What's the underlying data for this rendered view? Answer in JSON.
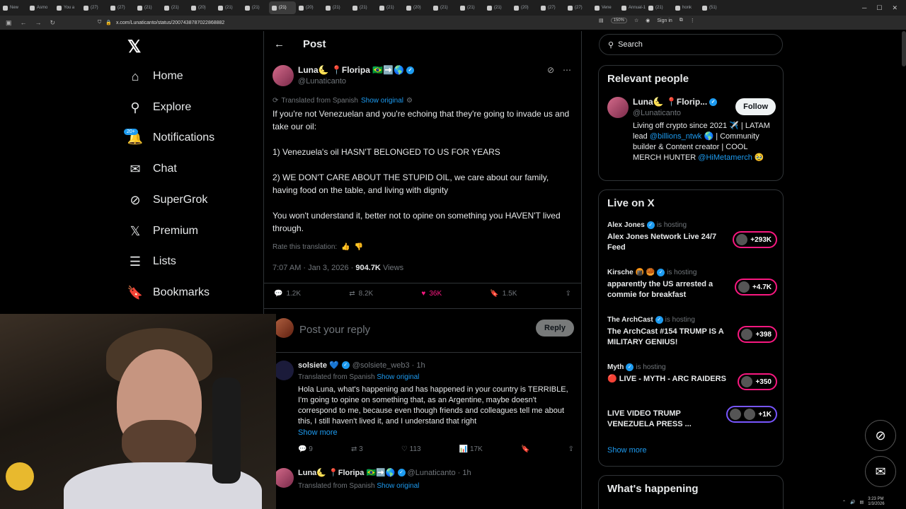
{
  "browser": {
    "tabs": [
      "New",
      "Asmo",
      "You a",
      "(27)",
      "(27)",
      "(21)",
      "(21)",
      "(20)",
      "(21)",
      "(21)",
      "(21)",
      "(20)",
      "(21)",
      "(21)",
      "(21)",
      "(20)",
      "(21)",
      "(21)",
      "(21)",
      "(20)",
      "(27)",
      "(27)",
      "Vene",
      "Annual-1",
      "(21)",
      "honk",
      "(51)"
    ],
    "active_tab_index": 10,
    "url": "x.com/Lunaticanto/status/2007438787022868882",
    "zoom": "150%",
    "sign_in": "Sign in"
  },
  "sidebar": {
    "items": [
      {
        "label": "Home",
        "icon": "home-icon"
      },
      {
        "label": "Explore",
        "icon": "search-icon"
      },
      {
        "label": "Notifications",
        "icon": "bell-icon",
        "badge": "20+"
      },
      {
        "label": "Chat",
        "icon": "mail-icon"
      },
      {
        "label": "SuperGrok",
        "icon": "grok-icon"
      },
      {
        "label": "Premium",
        "icon": "x-icon"
      },
      {
        "label": "Lists",
        "icon": "list-icon"
      },
      {
        "label": "Bookmarks",
        "icon": "bookmark-icon"
      }
    ]
  },
  "post": {
    "header": "Post",
    "author_name": "Luna🌜 📍Floripa 🇧🇷➡️🌎",
    "author_handle": "@Lunaticanto",
    "translated_label": "Translated from Spanish",
    "show_original": "Show original",
    "paragraphs": [
      "If you're not Venezuelan and you're echoing that they're going to invade us and take our oil:",
      "1) Venezuela's oil HASN'T BELONGED TO US FOR YEARS",
      "2) WE DON'T CARE ABOUT THE STUPID OIL, we care about our family, having food on the table, and living with dignity",
      "You won't understand it, better not to opine on something you HAVEN'T lived through."
    ],
    "rate_translation": "Rate this translation:",
    "time": "7:07 AM · Jan 3, 2026 · ",
    "views_count": "904.7K",
    "views_label": " Views",
    "actions": {
      "replies": "1.2K",
      "reposts": "8.2K",
      "likes": "36K",
      "bookmarks": "1.5K"
    },
    "reply_placeholder": "Post your reply",
    "reply_button": "Reply"
  },
  "comments": [
    {
      "name": "solsiete 💙",
      "handle": "@solsiete_web3 · 1h",
      "translated_label": "Translated from Spanish",
      "show_original": "Show original",
      "text": "Hola Luna, what's happening and has happened in your country is TERRIBLE, I'm going to opine on something that, as an Argentine, maybe doesn't correspond to me, because even though friends and colleagues tell me about this, I still haven't lived it, and I understand that right",
      "show_more": "Show more",
      "replies": "9",
      "reposts": "3",
      "likes": "113",
      "views": "17K"
    },
    {
      "name": "Luna🌜 📍Floripa 🇧🇷➡️🌎",
      "handle": "@Lunaticanto · 1h",
      "translated_label": "Translated from Spanish",
      "show_original": "Show original"
    }
  ],
  "right": {
    "search_placeholder": "Search",
    "relevant_title": "Relevant people",
    "relevant": {
      "name": "Luna🌜 📍Florip...",
      "handle": "@Lunaticanto",
      "follow": "Follow",
      "bio_1": "Living off crypto since 2021 ✈️ | LATAM lead ",
      "bio_link1": "@billions_ntwk",
      "bio_2": " 🌎 | Community builder & Content creator | COOL MERCH HUNTER ",
      "bio_link2": "@HiMetamerch",
      "bio_3": " 🥹"
    },
    "live_title": "Live on X",
    "live": [
      {
        "host": "Alex Jones",
        "hosting": "is hosting",
        "title": "Alex Jones Network Live 24/7 Feed",
        "count": "+293K"
      },
      {
        "host": "Kirsche 🍘 🥮",
        "hosting": "is hosting",
        "title": "apparently the US arrested a commie for breakfast",
        "count": "+4.7K"
      },
      {
        "host": "The ArchCast",
        "hosting": "is hosting",
        "title": "The ArchCast #154 TRUMP IS A MILITARY GENIUS!",
        "count": "+398"
      },
      {
        "host": "Myth",
        "hosting": "is hosting",
        "title": "🔴 LIVE - MYTH - ARC RAIDERS",
        "count": "+350"
      },
      {
        "host": "",
        "hosting": "",
        "title": "LIVE VIDEO TRUMP VENEZUELA PRESS ...",
        "count": "+1K"
      }
    ],
    "show_more": "Show more",
    "happening_title": "What's happening"
  },
  "taskbar": {
    "time": "3:23 PM",
    "date": "1/3/2026"
  }
}
